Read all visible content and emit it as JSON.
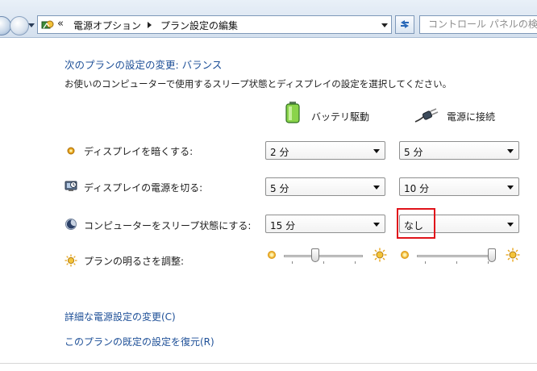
{
  "address_bar": {
    "chevron": "«",
    "crumbs": [
      "電源オプション",
      "プラン設定の編集"
    ],
    "search_placeholder": "コントロール パネルの検"
  },
  "heading": "次のプランの設定の変更: バランス",
  "description": "お使いのコンピューターで使用するスリープ状態とディスプレイの設定を選択してください。",
  "columns": {
    "battery": "バッテリ駆動",
    "plugged": "電源に接続"
  },
  "rows": [
    {
      "icon": "dim-display-icon",
      "label": "ディスプレイを暗くする:",
      "battery": "2 分",
      "plugged": "5 分"
    },
    {
      "icon": "display-off-icon",
      "label": "ディスプレイの電源を切る:",
      "battery": "5 分",
      "plugged": "10 分"
    },
    {
      "icon": "sleep-moon-icon",
      "label": "コンピューターをスリープ状態にする:",
      "battery": "15 分",
      "plugged": "なし"
    }
  ],
  "brightness": {
    "label": "プランの明るさを調整:",
    "battery_level": 0.4,
    "plugged_level": 0.95
  },
  "links": {
    "advanced": "詳細な電源設定の変更(C)",
    "restore": "このプランの既定の設定を復元(R)"
  },
  "colors": {
    "link": "#1d4f97",
    "highlight": "#e0131a"
  }
}
